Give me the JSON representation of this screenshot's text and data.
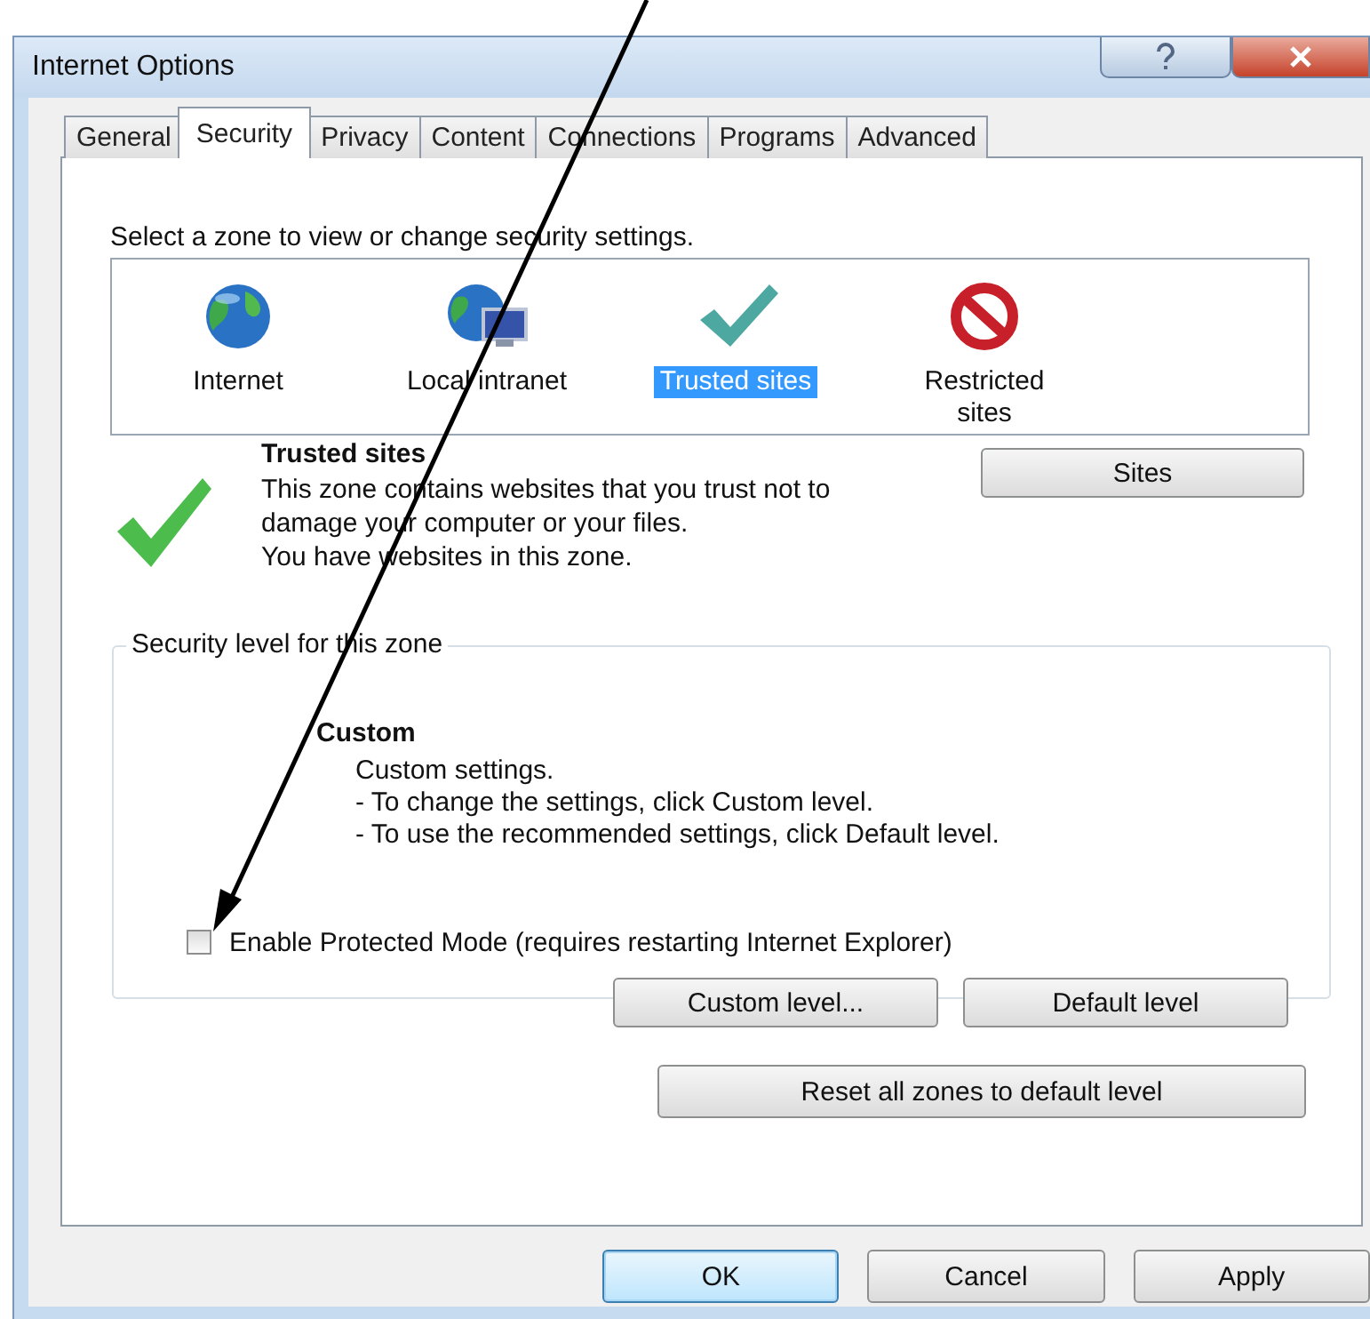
{
  "window": {
    "title": "Internet Options"
  },
  "tabs": [
    {
      "label": "General",
      "selected": false
    },
    {
      "label": "Security",
      "selected": true
    },
    {
      "label": "Privacy",
      "selected": false
    },
    {
      "label": "Content",
      "selected": false
    },
    {
      "label": "Connections",
      "selected": false
    },
    {
      "label": "Programs",
      "selected": false
    },
    {
      "label": "Advanced",
      "selected": false
    }
  ],
  "zones": {
    "prompt": "Select a zone to view or change security settings.",
    "items": [
      {
        "label": "Internet",
        "kind": "globe",
        "selected": false
      },
      {
        "label": "Local intranet",
        "kind": "intranet",
        "selected": false
      },
      {
        "label": "Trusted sites",
        "kind": "check",
        "selected": true
      },
      {
        "label": "Restricted sites",
        "kind": "blocked",
        "selected": false
      }
    ]
  },
  "zone_info": {
    "title": "Trusted sites",
    "description": "This zone contains websites that you trust not to damage your computer or your files.",
    "status": "You have websites in this zone.",
    "button": "Sites"
  },
  "security_level": {
    "legend": "Security level for this zone",
    "level": "Custom",
    "description": [
      "Custom settings.",
      "- To change the settings, click Custom level.",
      "- To use the recommended settings, click Default level."
    ],
    "protected_mode": {
      "label": "Enable Protected Mode (requires restarting Internet Explorer)",
      "checked": false
    },
    "buttons": [
      "Custom level...",
      "Default level"
    ]
  },
  "reset_button": "Reset all zones to default level",
  "dialog_buttons": [
    {
      "label": "OK",
      "default": true
    },
    {
      "label": "Cancel",
      "default": false
    },
    {
      "label": "Apply",
      "default": false
    }
  ]
}
